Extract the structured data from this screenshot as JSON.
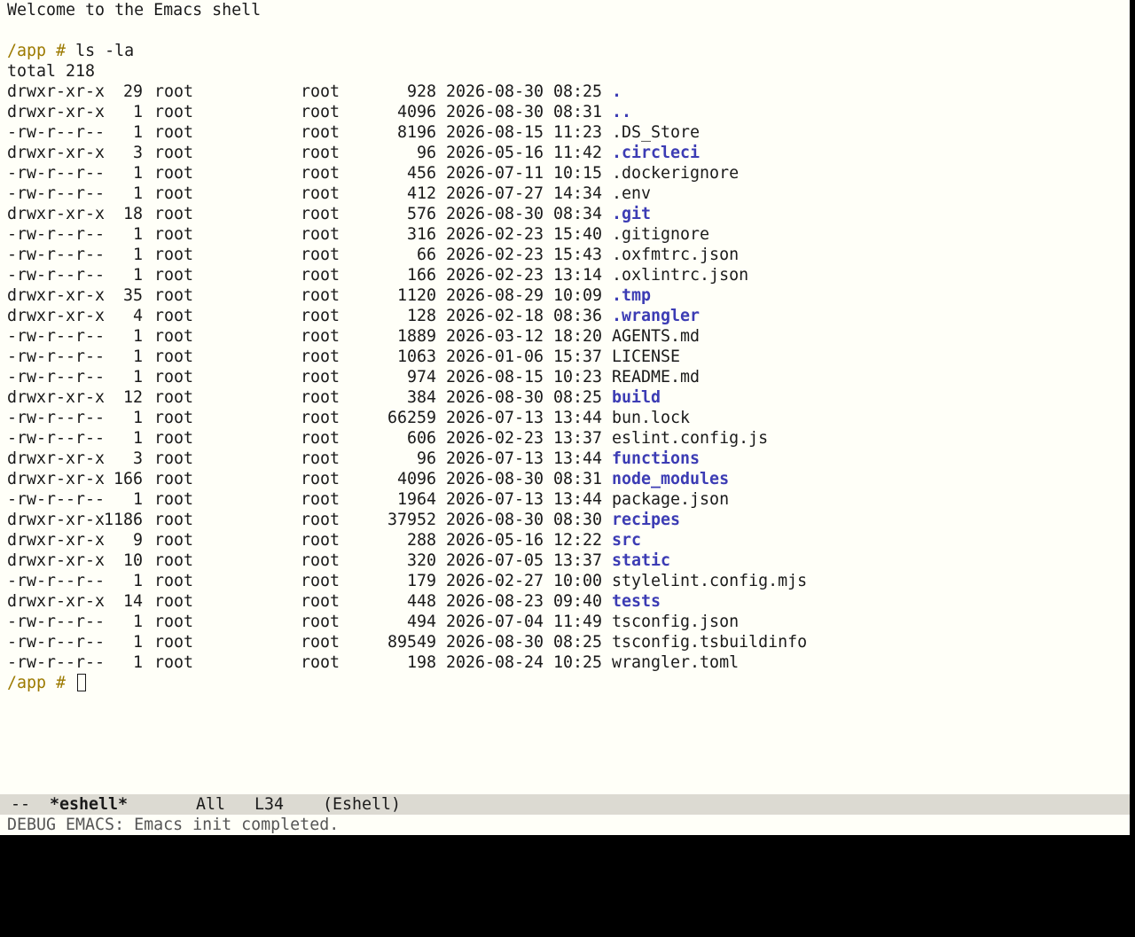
{
  "welcome": "Welcome to the Emacs shell",
  "prompt": {
    "dir": "/app",
    "symbol": "#"
  },
  "command": "ls -la",
  "total": "total 218",
  "entries": [
    {
      "perms": "drwxr-xr-x",
      "links": "29",
      "owner": "root",
      "group": "root",
      "size": "928",
      "date": "2026-08-30",
      "time": "08:25",
      "name": ".",
      "is_dir": true
    },
    {
      "perms": "drwxr-xr-x",
      "links": "1",
      "owner": "root",
      "group": "root",
      "size": "4096",
      "date": "2026-08-30",
      "time": "08:31",
      "name": "..",
      "is_dir": true
    },
    {
      "perms": "-rw-r--r--",
      "links": "1",
      "owner": "root",
      "group": "root",
      "size": "8196",
      "date": "2026-08-15",
      "time": "11:23",
      "name": ".DS_Store",
      "is_dir": false
    },
    {
      "perms": "drwxr-xr-x",
      "links": "3",
      "owner": "root",
      "group": "root",
      "size": "96",
      "date": "2026-05-16",
      "time": "11:42",
      "name": ".circleci",
      "is_dir": true
    },
    {
      "perms": "-rw-r--r--",
      "links": "1",
      "owner": "root",
      "group": "root",
      "size": "456",
      "date": "2026-07-11",
      "time": "10:15",
      "name": ".dockerignore",
      "is_dir": false
    },
    {
      "perms": "-rw-r--r--",
      "links": "1",
      "owner": "root",
      "group": "root",
      "size": "412",
      "date": "2026-07-27",
      "time": "14:34",
      "name": ".env",
      "is_dir": false
    },
    {
      "perms": "drwxr-xr-x",
      "links": "18",
      "owner": "root",
      "group": "root",
      "size": "576",
      "date": "2026-08-30",
      "time": "08:34",
      "name": ".git",
      "is_dir": true
    },
    {
      "perms": "-rw-r--r--",
      "links": "1",
      "owner": "root",
      "group": "root",
      "size": "316",
      "date": "2026-02-23",
      "time": "15:40",
      "name": ".gitignore",
      "is_dir": false
    },
    {
      "perms": "-rw-r--r--",
      "links": "1",
      "owner": "root",
      "group": "root",
      "size": "66",
      "date": "2026-02-23",
      "time": "15:43",
      "name": ".oxfmtrc.json",
      "is_dir": false
    },
    {
      "perms": "-rw-r--r--",
      "links": "1",
      "owner": "root",
      "group": "root",
      "size": "166",
      "date": "2026-02-23",
      "time": "13:14",
      "name": ".oxlintrc.json",
      "is_dir": false
    },
    {
      "perms": "drwxr-xr-x",
      "links": "35",
      "owner": "root",
      "group": "root",
      "size": "1120",
      "date": "2026-08-29",
      "time": "10:09",
      "name": ".tmp",
      "is_dir": true
    },
    {
      "perms": "drwxr-xr-x",
      "links": "4",
      "owner": "root",
      "group": "root",
      "size": "128",
      "date": "2026-02-18",
      "time": "08:36",
      "name": ".wrangler",
      "is_dir": true
    },
    {
      "perms": "-rw-r--r--",
      "links": "1",
      "owner": "root",
      "group": "root",
      "size": "1889",
      "date": "2026-03-12",
      "time": "18:20",
      "name": "AGENTS.md",
      "is_dir": false
    },
    {
      "perms": "-rw-r--r--",
      "links": "1",
      "owner": "root",
      "group": "root",
      "size": "1063",
      "date": "2026-01-06",
      "time": "15:37",
      "name": "LICENSE",
      "is_dir": false
    },
    {
      "perms": "-rw-r--r--",
      "links": "1",
      "owner": "root",
      "group": "root",
      "size": "974",
      "date": "2026-08-15",
      "time": "10:23",
      "name": "README.md",
      "is_dir": false
    },
    {
      "perms": "drwxr-xr-x",
      "links": "12",
      "owner": "root",
      "group": "root",
      "size": "384",
      "date": "2026-08-30",
      "time": "08:25",
      "name": "build",
      "is_dir": true
    },
    {
      "perms": "-rw-r--r--",
      "links": "1",
      "owner": "root",
      "group": "root",
      "size": "66259",
      "date": "2026-07-13",
      "time": "13:44",
      "name": "bun.lock",
      "is_dir": false
    },
    {
      "perms": "-rw-r--r--",
      "links": "1",
      "owner": "root",
      "group": "root",
      "size": "606",
      "date": "2026-02-23",
      "time": "13:37",
      "name": "eslint.config.js",
      "is_dir": false
    },
    {
      "perms": "drwxr-xr-x",
      "links": "3",
      "owner": "root",
      "group": "root",
      "size": "96",
      "date": "2026-07-13",
      "time": "13:44",
      "name": "functions",
      "is_dir": true
    },
    {
      "perms": "drwxr-xr-x",
      "links": "166",
      "owner": "root",
      "group": "root",
      "size": "4096",
      "date": "2026-08-30",
      "time": "08:31",
      "name": "node_modules",
      "is_dir": true
    },
    {
      "perms": "-rw-r--r--",
      "links": "1",
      "owner": "root",
      "group": "root",
      "size": "1964",
      "date": "2026-07-13",
      "time": "13:44",
      "name": "package.json",
      "is_dir": false
    },
    {
      "perms": "drwxr-xr-x",
      "links": "1186",
      "owner": "root",
      "group": "root",
      "size": "37952",
      "date": "2026-08-30",
      "time": "08:30",
      "name": "recipes",
      "is_dir": true
    },
    {
      "perms": "drwxr-xr-x",
      "links": "9",
      "owner": "root",
      "group": "root",
      "size": "288",
      "date": "2026-05-16",
      "time": "12:22",
      "name": "src",
      "is_dir": true
    },
    {
      "perms": "drwxr-xr-x",
      "links": "10",
      "owner": "root",
      "group": "root",
      "size": "320",
      "date": "2026-07-05",
      "time": "13:37",
      "name": "static",
      "is_dir": true
    },
    {
      "perms": "-rw-r--r--",
      "links": "1",
      "owner": "root",
      "group": "root",
      "size": "179",
      "date": "2026-02-27",
      "time": "10:00",
      "name": "stylelint.config.mjs",
      "is_dir": false
    },
    {
      "perms": "drwxr-xr-x",
      "links": "14",
      "owner": "root",
      "group": "root",
      "size": "448",
      "date": "2026-08-23",
      "time": "09:40",
      "name": "tests",
      "is_dir": true
    },
    {
      "perms": "-rw-r--r--",
      "links": "1",
      "owner": "root",
      "group": "root",
      "size": "494",
      "date": "2026-07-04",
      "time": "11:49",
      "name": "tsconfig.json",
      "is_dir": false
    },
    {
      "perms": "-rw-r--r--",
      "links": "1",
      "owner": "root",
      "group": "root",
      "size": "89549",
      "date": "2026-08-30",
      "time": "08:25",
      "name": "tsconfig.tsbuildinfo",
      "is_dir": false
    },
    {
      "perms": "-rw-r--r--",
      "links": "1",
      "owner": "root",
      "group": "root",
      "size": "198",
      "date": "2026-08-24",
      "time": "10:25",
      "name": "wrangler.toml",
      "is_dir": false
    }
  ],
  "mode_line": {
    "status": "--",
    "buffer_name": "*eshell*",
    "position": "All",
    "line": "L34",
    "mode": "(Eshell)"
  },
  "echo_area": "DEBUG EMACS: Emacs init completed.",
  "colors": {
    "background": "#fffff8",
    "prompt": "#9c7a00",
    "directory": "#3c3cb4",
    "mode_line_bg": "#dcdad2"
  }
}
